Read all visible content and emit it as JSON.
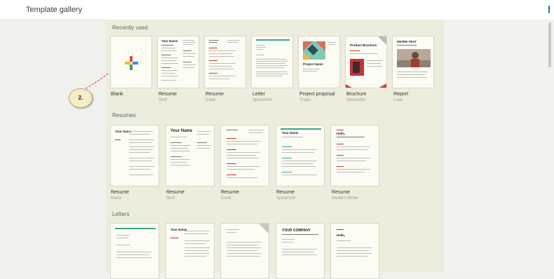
{
  "app": {
    "title": "Template gallery"
  },
  "sections": {
    "recent": {
      "title": "Recently used",
      "items": [
        {
          "name": "Blank",
          "sub": ""
        },
        {
          "name": "Resume",
          "sub": "Serif"
        },
        {
          "name": "Resume",
          "sub": "Coral"
        },
        {
          "name": "Letter",
          "sub": "Spearmint"
        },
        {
          "name": "Project proposal",
          "sub": "Tropic"
        },
        {
          "name": "Brochure",
          "sub": "Geometric"
        },
        {
          "name": "Report",
          "sub": "Luxe"
        }
      ]
    },
    "resumes": {
      "title": "Resumes",
      "items": [
        {
          "name": "Resume",
          "sub": "Swiss"
        },
        {
          "name": "Resume",
          "sub": "Serif"
        },
        {
          "name": "Resume",
          "sub": "Coral"
        },
        {
          "name": "Resume",
          "sub": "Spearmint"
        },
        {
          "name": "Resume",
          "sub": "Modern Writer"
        }
      ]
    },
    "letters": {
      "title": "Letters"
    }
  },
  "thumbs": {
    "your_name": "Your Name",
    "hello": "Hello,",
    "project_name": "Project Name",
    "product_brochure": "Product Brochure",
    "company": "YOUR COMPANY",
    "report_title": "ENTER TEXT"
  },
  "callout": {
    "label": "2."
  },
  "colors": {
    "background": "#f0f1ec",
    "panel": "#ededde",
    "card": "#fcfcf4",
    "accent_red": "#c0392b",
    "accent_green": "#3aa58a"
  }
}
